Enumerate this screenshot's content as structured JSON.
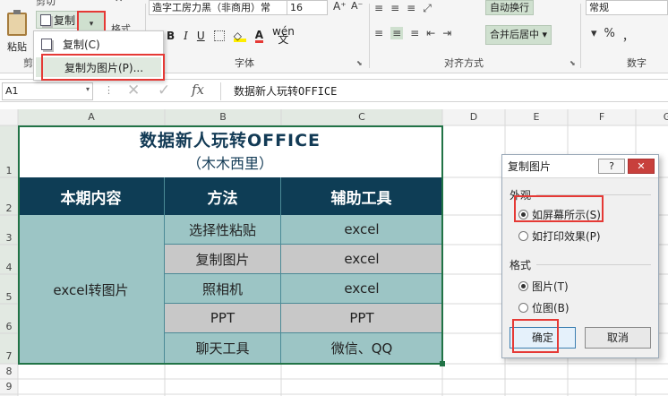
{
  "ribbon": {
    "cut_label": "剪切",
    "paste_label": "粘贴",
    "copy_label": "复制",
    "format_painter_label": "格式",
    "clipboard_group": "剪贴板",
    "font_name": "造字工房力黑（非商用）常",
    "font_size": "16",
    "grow_font": "A⁺",
    "shrink_font": "A⁻",
    "bold": "B",
    "italic": "I",
    "underline": "U",
    "font_color_glyph": "A",
    "wen_glyph": "wén\n文",
    "font_group": "字体",
    "wrap_text": "自动换行",
    "merge_center": "合并后居中 ▾",
    "align_group": "对齐方式",
    "number_format": "常规",
    "number_group": "数字",
    "num_buttons": [
      "▾",
      "%",
      "，"
    ]
  },
  "copy_menu": {
    "copy": "复制(C)",
    "copy_as_picture": "复制为图片(P)..."
  },
  "formula_bar": {
    "name_box": "A1",
    "cancel": "✕",
    "enter": "✓",
    "fx": "fx",
    "content": "数据新人玩转OFFICE"
  },
  "sheet": {
    "columns": [
      "A",
      "B",
      "C",
      "D",
      "E",
      "F",
      "G"
    ],
    "rows": [
      "1",
      "2",
      "3",
      "4",
      "5",
      "6",
      "7",
      "8",
      "9"
    ],
    "title": "数据新人玩转OFFICE",
    "subtitle": "（木木西里）",
    "headers": [
      "本期内容",
      "方法",
      "辅助工具"
    ],
    "merged_content": "excel转图片",
    "rows_data": [
      {
        "method": "选择性粘贴",
        "tool": "excel",
        "shade": "teal"
      },
      {
        "method": "复制图片",
        "tool": "excel",
        "shade": "grey"
      },
      {
        "method": "照相机",
        "tool": "excel",
        "shade": "teal"
      },
      {
        "method": "PPT",
        "tool": "PPT",
        "shade": "grey"
      },
      {
        "method": "聊天工具",
        "tool": "微信、QQ",
        "shade": "teal"
      }
    ]
  },
  "dialog": {
    "title": "复制图片",
    "help": "?",
    "close": "✕",
    "appearance_label": "外观",
    "appearance_options": [
      "如屏幕所示(S)",
      "如打印效果(P)"
    ],
    "format_label": "格式",
    "format_options": [
      "图片(T)",
      "位图(B)"
    ],
    "ok": "确定",
    "cancel": "取消"
  },
  "colors": {
    "header_fill": "#0e3d55",
    "teal_fill": "#9cc5c5",
    "grey_fill": "#c8c8c8",
    "highlight_red": "#e53935",
    "selection_green": "#217346"
  }
}
